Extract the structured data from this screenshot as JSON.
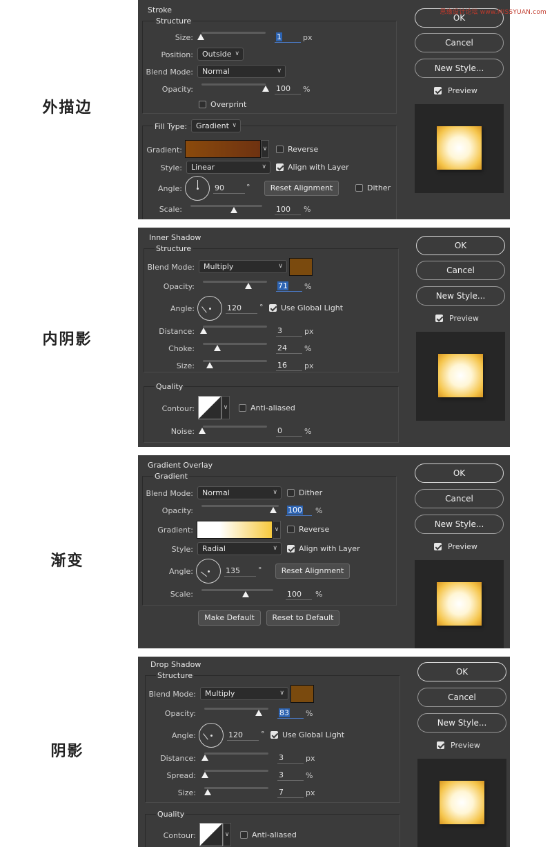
{
  "watermark": "思缘设计论坛 www.MISSYUAN.com",
  "labels": {
    "stroke": "外描边",
    "inner_shadow": "内阴影",
    "gradient": "渐变",
    "drop_shadow": "阴影"
  },
  "buttons": {
    "ok": "OK",
    "cancel": "Cancel",
    "new_style": "New Style...",
    "preview": "Preview"
  },
  "stroke": {
    "title": "Stroke",
    "structure": "Structure",
    "size_label": "Size:",
    "size": "1",
    "size_unit": "px",
    "position_label": "Position:",
    "position": "Outside",
    "blend_label": "Blend Mode:",
    "blend": "Normal",
    "opacity_label": "Opacity:",
    "opacity": "100",
    "opacity_unit": "%",
    "overprint": "Overprint",
    "fill_label": "Fill Type:",
    "fill": "Gradient",
    "gradient_label": "Gradient:",
    "reverse": "Reverse",
    "style_label": "Style:",
    "style": "Linear",
    "align": "Align with Layer",
    "angle_label": "Angle:",
    "angle": "90",
    "angle_unit": "°",
    "reset": "Reset Alignment",
    "dither": "Dither",
    "scale_label": "Scale:",
    "scale": "100",
    "scale_unit": "%",
    "colors": {
      "gradient_from": "#8a4a0c",
      "gradient_to": "#6e3211"
    }
  },
  "inner_shadow": {
    "title": "Inner Shadow",
    "structure": "Structure",
    "blend_label": "Blend Mode:",
    "blend": "Multiply",
    "opacity_label": "Opacity:",
    "opacity": "71",
    "opacity_unit": "%",
    "angle_label": "Angle:",
    "angle": "120",
    "angle_unit": "°",
    "global_light": "Use Global Light",
    "distance_label": "Distance:",
    "distance": "3",
    "distance_unit": "px",
    "choke_label": "Choke:",
    "choke": "24",
    "choke_unit": "%",
    "size_label": "Size:",
    "size": "16",
    "size_unit": "px",
    "quality": "Quality",
    "contour_label": "Contour:",
    "anti_aliased": "Anti-aliased",
    "noise_label": "Noise:",
    "noise": "0",
    "noise_unit": "%",
    "colors": {
      "swatch": "#7a4a0e"
    }
  },
  "gradient_overlay": {
    "title": "Gradient Overlay",
    "structure": "Gradient",
    "blend_label": "Blend Mode:",
    "blend": "Normal",
    "dither": "Dither",
    "opacity_label": "Opacity:",
    "opacity": "100",
    "opacity_unit": "%",
    "gradient_label": "Gradient:",
    "reverse": "Reverse",
    "style_label": "Style:",
    "style": "Radial",
    "align": "Align with Layer",
    "angle_label": "Angle:",
    "angle": "135",
    "angle_unit": "°",
    "reset": "Reset Alignment",
    "scale_label": "Scale:",
    "scale": "100",
    "scale_unit": "%",
    "make_default": "Make Default",
    "reset_default": "Reset to Default",
    "colors": {
      "gradient_from": "#ffffff",
      "gradient_to": "#f6c93e"
    }
  },
  "drop_shadow": {
    "title": "Drop Shadow",
    "structure": "Structure",
    "blend_label": "Blend Mode:",
    "blend": "Multiply",
    "opacity_label": "Opacity:",
    "opacity": "83",
    "opacity_unit": "%",
    "angle_label": "Angle:",
    "angle": "120",
    "angle_unit": "°",
    "global_light": "Use Global Light",
    "distance_label": "Distance:",
    "distance": "3",
    "distance_unit": "px",
    "spread_label": "Spread:",
    "spread": "3",
    "spread_unit": "%",
    "size_label": "Size:",
    "size": "7",
    "size_unit": "px",
    "quality": "Quality",
    "contour_label": "Contour:",
    "anti_aliased": "Anti-aliased",
    "colors": {
      "swatch": "#7a4a0e"
    }
  }
}
